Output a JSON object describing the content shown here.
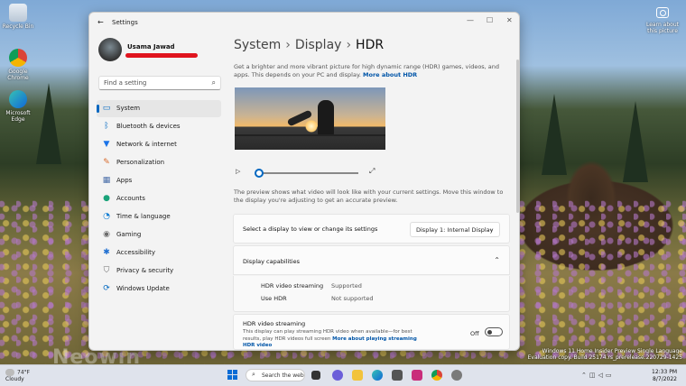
{
  "desktop": {
    "icons": [
      {
        "label": "Recycle Bin",
        "icon": "recycle-bin-icon"
      },
      {
        "label": "Google Chrome",
        "icon": "chrome-icon"
      },
      {
        "label": "Microsoft Edge",
        "icon": "edge-icon"
      }
    ],
    "learn_label": "Learn about this picture",
    "watermark_line1": "Windows 11 Home Insider Preview Single Language",
    "watermark_line2": "Evaluation copy. Build 25174.rs_prerelease.220729-1425",
    "neowin": "Neowin"
  },
  "window": {
    "title": "Settings",
    "controls": [
      "minimize",
      "maximize",
      "close"
    ]
  },
  "user": {
    "name": "Usama Jawad"
  },
  "sidebar": {
    "search_placeholder": "Find a setting",
    "items": [
      {
        "label": "System",
        "icon": "monitor-icon",
        "selected": true,
        "color": "#0067c0"
      },
      {
        "label": "Bluetooth & devices",
        "icon": "bluetooth-icon",
        "color": "#0067c0"
      },
      {
        "label": "Network & internet",
        "icon": "wifi-icon",
        "color": "#1a73e8"
      },
      {
        "label": "Personalization",
        "icon": "brush-icon",
        "color": "#d86a2b"
      },
      {
        "label": "Apps",
        "icon": "apps-icon",
        "color": "#4a6ea9"
      },
      {
        "label": "Accounts",
        "icon": "person-icon",
        "color": "#1aa37a"
      },
      {
        "label": "Time & language",
        "icon": "globe-clock-icon",
        "color": "#0b7bd3"
      },
      {
        "label": "Gaming",
        "icon": "gamepad-icon",
        "color": "#6b6b6b"
      },
      {
        "label": "Accessibility",
        "icon": "accessibility-icon",
        "color": "#1f6fd1"
      },
      {
        "label": "Privacy & security",
        "icon": "shield-icon",
        "color": "#6b6b6b"
      },
      {
        "label": "Windows Update",
        "icon": "update-icon",
        "color": "#0067c0"
      }
    ]
  },
  "main": {
    "breadcrumb": [
      "System",
      "Display",
      "HDR"
    ],
    "description": "Get a brighter and more vibrant picture for high dynamic range (HDR) games, videos, and apps. This depends on your PC and display.",
    "description_link": "More about HDR",
    "preview_note": "The preview shows what video will look like with your current settings. Move this window to the display you're adjusting to get an accurate preview.",
    "display_select_label": "Select a display to view or change its settings",
    "display_select_value": "Display 1: Internal Display",
    "capabilities_title": "Display capabilities",
    "capabilities": [
      {
        "label": "HDR video streaming",
        "value": "Supported"
      },
      {
        "label": "Use HDR",
        "value": "Not supported"
      }
    ],
    "streaming_title": "HDR video streaming",
    "streaming_desc": "This display can play streaming HDR video when available—for best results, play HDR videos full screen",
    "streaming_link": "More about playing streaming HDR video",
    "streaming_state": "Off"
  },
  "taskbar": {
    "weather_temp": "74°F",
    "weather_desc": "Cloudy",
    "search_label": "Search the web",
    "time": "12:33 PM",
    "date": "8/7/2022"
  }
}
